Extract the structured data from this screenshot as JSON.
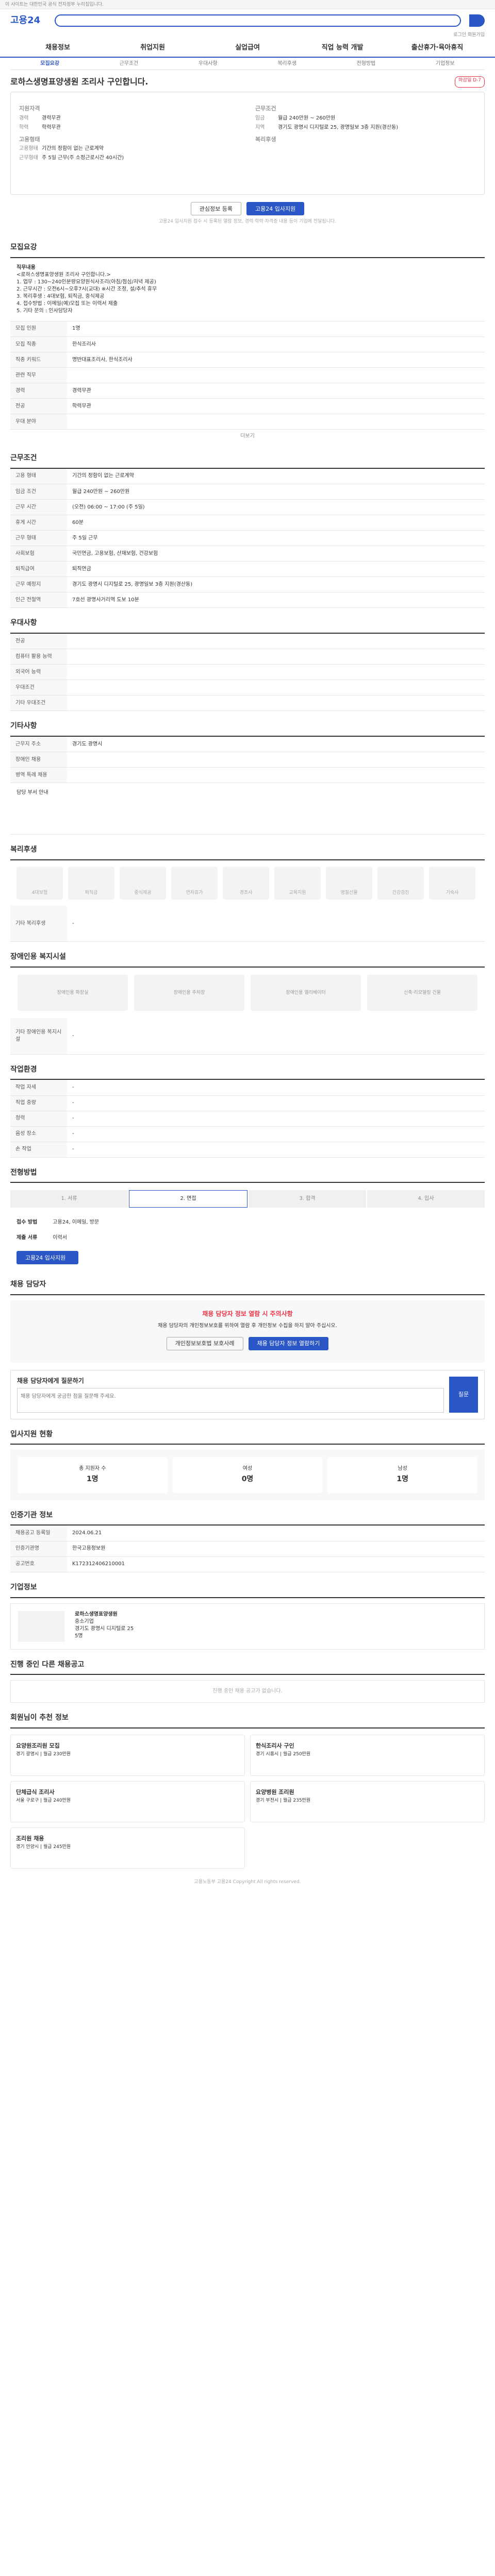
{
  "topbar": "이 사이트는 대한민국 공식 전자정부 누리집입니다.",
  "site": {
    "logo": "고용24",
    "util": "로그인 회원가입"
  },
  "gnb": [
    "채용정보",
    "취업지원",
    "실업급여",
    "직업 능력 개발",
    "출산휴가·육아휴직"
  ],
  "tabs": [
    "모집요강",
    "근무조건",
    "우대사항",
    "복리후생",
    "전형방법",
    "기업정보"
  ],
  "job": {
    "title": "로하스생명표양생원 조리사 구인합니다.",
    "badge": "마감일 D-7"
  },
  "summary": {
    "qual": {
      "h": "지원자격",
      "rows": [
        [
          "경력",
          "경력무관"
        ],
        [
          "학력",
          "학력무관"
        ]
      ]
    },
    "cond": {
      "h": "근무조건",
      "rows": [
        [
          "임금",
          "월급 240만원 ~ 260만원"
        ],
        [
          "지역",
          "경기도 광명시 디지털로 25, 광명일보 3층 지원(경산동)"
        ]
      ]
    },
    "form": {
      "h": "고용형태",
      "rows": [
        [
          "고용형태",
          "기간의 정함이 없는 근로계약"
        ],
        [
          "근무형태",
          "주 5일 근무(주 소정근로시간 40시간)"
        ]
      ]
    },
    "welf": {
      "h": "복리후생"
    }
  },
  "actions": {
    "scrap": "관심정보 등록",
    "apply": "고용24 입사지원"
  },
  "note": "고용24 입사지원 접수 시 등록된 열람 정보, 경력·학력·자격증 내용 등이 기업에 전달됩니다.",
  "recruit": {
    "h": "모집요강",
    "job_title": "직무내용",
    "job_body": "<로하스생명표양생원 조리사 구인합니다.>\n1. 업무 : 130~240인분량요양원식사조리(아침/점심/저녁 제공)\n2. 근무시간 : 오전6시~오후7시(교대) ※시간 조정, 설/추석 휴무\n3. 복리후생 : 4대보험, 퇴직금, 중식제공\n4. 접수방법 : 이메일(예)모집 또는 이력서 제출\n5. 기타 문의 : 인사담당자",
    "rows": [
      [
        "모집 인원",
        "1명"
      ],
      [
        "모집 직종",
        "한식조리사"
      ],
      [
        "직종 키워드",
        "명반대표조리사, 한식조리사"
      ],
      [
        "관련 직무",
        ""
      ],
      [
        "경력",
        "경력무관"
      ],
      [
        "전공",
        "학력무관"
      ],
      [
        "우대 분야",
        ""
      ]
    ],
    "more": "더보기"
  },
  "work": {
    "h": "근무조건",
    "rows": [
      [
        "고용 형태",
        "기간의 정함이 없는 근로계약"
      ],
      [
        "임금 조건",
        "월급 240만원 ~ 260만원"
      ],
      [
        "근무 시간",
        "(오전) 06:00 ~ 17:00 (주 5일)"
      ],
      [
        "휴게 시간",
        "60분"
      ],
      [
        "근무 형태",
        "주 5일 근무"
      ],
      [
        "사회보험",
        "국민연금, 고용보험, 산재보험, 건강보험"
      ],
      [
        "퇴직급여",
        "퇴직연금"
      ],
      [
        "근무 예정지",
        "경기도 광명시 디지털로 25, 광명일보 3층 지원(경산동)"
      ],
      [
        "인근 전철역",
        "7호선 광명사거리역 도보 10분"
      ]
    ]
  },
  "pref": {
    "h": "우대사항",
    "rows": [
      [
        "전공",
        ""
      ],
      [
        "컴퓨터 활용 능력",
        ""
      ],
      [
        "외국어 능력",
        ""
      ],
      [
        "우대조건",
        ""
      ],
      [
        "기타 우대조건",
        ""
      ]
    ]
  },
  "other": {
    "h": "기타사항",
    "rows": [
      [
        "근무지 주소",
        "경기도 광명시"
      ],
      [
        "장애인 채용",
        ""
      ],
      [
        "병역 특례 채용",
        ""
      ]
    ],
    "extra": "담당 부서 안내"
  },
  "welfare": {
    "h": "복리후생",
    "items": [
      "4대보험",
      "퇴직금",
      "중식제공",
      "연차휴가",
      "경조사",
      "교육지원",
      "명절선물",
      "건강검진",
      "기숙사"
    ],
    "etc_k": "기타 복리후생",
    "etc": "-"
  },
  "disabled": {
    "h": "장애인용 복지시설",
    "items": [
      "장애인용 화장실",
      "장애인용 주차장",
      "장애인용 엘리베이터",
      "신축·리모델링 건물"
    ],
    "etc_k": "기타 장애인용 복지시설",
    "etc": "-"
  },
  "office": {
    "h": "작업환경",
    "rows": [
      [
        "작업 자세",
        "-"
      ],
      [
        "직업 중량",
        "-"
      ],
      [
        "청력",
        "-"
      ],
      [
        "음성 장소",
        "-"
      ],
      [
        "손 작업",
        "-"
      ]
    ]
  },
  "process": {
    "h": "전형방법",
    "steps": [
      "1. 서류",
      "2. 면접",
      "3. 합격",
      "4. 입사"
    ],
    "method_k": "접수 방법",
    "method": "고용24, 이메일, 방문",
    "docs_k": "제출 서류",
    "docs": "이력서"
  },
  "contact": {
    "h": "채용 담당자",
    "warn": "채용 담당자 정보 열람 시 주의사항",
    "msg": "채용 담당자의 개인정보보호를 위하여 열람 후 개인정보 수집을 하지 말아 주십시오.",
    "btn1": "개인정보보호법 보호사례",
    "btn2": "채용 담당자 정보 열람하기"
  },
  "qna": {
    "h": "채용 담당자에게 질문하기",
    "placeholder": "채용 담당자에게 궁금한 점을 질문해 주세요.",
    "submit": "질문"
  },
  "apply": {
    "h": "입사지원 현황",
    "items": [
      [
        "총 지원자 수",
        "1명"
      ],
      [
        "여성",
        "0명"
      ],
      [
        "남성",
        "1명"
      ]
    ]
  },
  "reg": {
    "h": "인증기관 정보",
    "rows": [
      [
        "채용공고 등록일",
        "2024.06.21"
      ],
      [
        "인증기관명",
        "한국고용정보원"
      ],
      [
        "공고번호",
        "K172312406210001"
      ]
    ]
  },
  "company": {
    "h": "기업정보",
    "name": "로하스생명표양생원",
    "type": "중소기업",
    "addr": "경기도 광명시 디지털로 25",
    "emp": "5명"
  },
  "others_h": "진행 중인 다른 채용공고",
  "others_empty": "진행 중인 채용 공고가 없습니다.",
  "reco": {
    "h": "회원님이 추천 정보",
    "items": [
      [
        "요양원조리원 모집",
        "경기 광명시 | 월급 230만원"
      ],
      [
        "한식조리사 구인",
        "경기 시흥시 | 월급 250만원"
      ],
      [
        "단체급식 조리사",
        "서울 구로구 | 월급 240만원"
      ],
      [
        "요양병원 조리원",
        "경기 부천시 | 월급 235만원"
      ],
      [
        "조리원 채용",
        "경기 안양시 | 월급 245만원"
      ]
    ]
  },
  "footer": "고용노동부 고용24 Copyright All rights reserved."
}
